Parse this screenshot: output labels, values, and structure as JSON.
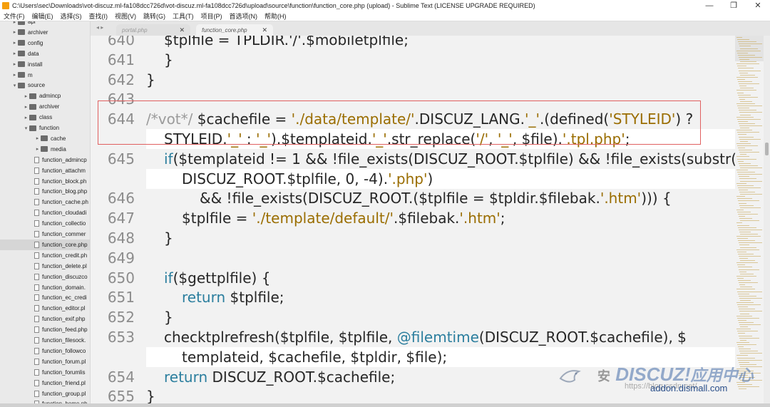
{
  "window": {
    "title": "C:\\Users\\sec\\Downloads\\vot-discuz.ml-fa108dcc726d\\vot-discuz.ml-fa108dcc726d\\upload\\source\\function\\function_core.php (upload) - Sublime Text (LICENSE UPGRADE REQUIRED)",
    "minimize": "—",
    "restore": "❐",
    "close": "✕"
  },
  "menu": [
    "文件(F)",
    "编辑(E)",
    "选择(S)",
    "查找(I)",
    "视图(V)",
    "跳转(G)",
    "工具(T)",
    "项目(P)",
    "首选项(N)",
    "帮助(H)"
  ],
  "sidebar": {
    "items": [
      {
        "label": "api",
        "type": "folder",
        "expanded": false
      },
      {
        "label": "archiver",
        "type": "folder",
        "expanded": false
      },
      {
        "label": "config",
        "type": "folder",
        "expanded": false
      },
      {
        "label": "data",
        "type": "folder",
        "expanded": false
      },
      {
        "label": "install",
        "type": "folder",
        "expanded": false
      },
      {
        "label": "m",
        "type": "folder",
        "expanded": false
      },
      {
        "label": "source",
        "type": "folder",
        "expanded": true
      },
      {
        "label": "admincp",
        "type": "folder",
        "expanded": false
      },
      {
        "label": "archiver",
        "type": "folder",
        "expanded": false
      },
      {
        "label": "class",
        "type": "folder",
        "expanded": false
      },
      {
        "label": "function",
        "type": "folder",
        "expanded": true
      },
      {
        "label": "cache",
        "type": "folder",
        "expanded": false
      },
      {
        "label": "media",
        "type": "folder",
        "expanded": false
      },
      {
        "label": "function_admincp",
        "type": "file"
      },
      {
        "label": "function_attachm",
        "type": "file"
      },
      {
        "label": "function_block.ph",
        "type": "file"
      },
      {
        "label": "function_blog.php",
        "type": "file"
      },
      {
        "label": "function_cache.ph",
        "type": "file"
      },
      {
        "label": "function_cloudadi",
        "type": "file"
      },
      {
        "label": "function_collectio",
        "type": "file"
      },
      {
        "label": "function_commer",
        "type": "file"
      },
      {
        "label": "function_core.php",
        "type": "file",
        "selected": true
      },
      {
        "label": "function_credit.ph",
        "type": "file"
      },
      {
        "label": "function_delete.pl",
        "type": "file"
      },
      {
        "label": "function_discuzco",
        "type": "file"
      },
      {
        "label": "function_domain.",
        "type": "file"
      },
      {
        "label": "function_ec_credi",
        "type": "file"
      },
      {
        "label": "function_editor.pl",
        "type": "file"
      },
      {
        "label": "function_exif.php",
        "type": "file"
      },
      {
        "label": "function_feed.php",
        "type": "file"
      },
      {
        "label": "function_filesock.",
        "type": "file"
      },
      {
        "label": "function_followco",
        "type": "file"
      },
      {
        "label": "function_forum.pl",
        "type": "file"
      },
      {
        "label": "function_forumlis",
        "type": "file"
      },
      {
        "label": "function_friend.pl",
        "type": "file"
      },
      {
        "label": "function_group.pl",
        "type": "file"
      },
      {
        "label": "function_home.ph",
        "type": "file"
      }
    ]
  },
  "tabs": {
    "nav": "◂ ▸",
    "items": [
      {
        "label": "portal.php",
        "active": false,
        "close": "✕"
      },
      {
        "label": "function_core.php",
        "active": true,
        "close": "✕"
      }
    ]
  },
  "editor": {
    "lines": [
      {
        "num": "640",
        "wrap": false,
        "indent": 1,
        "tokens": [
          [
            "$tplfile = TPLDIR.'/'.$mobiletplfile;",
            "plain"
          ]
        ]
      },
      {
        "num": "641",
        "wrap": false,
        "indent": 1,
        "tokens": [
          [
            "}",
            "plain"
          ]
        ]
      },
      {
        "num": "642",
        "wrap": false,
        "indent": 0,
        "tokens": [
          [
            "}",
            "plain"
          ]
        ]
      },
      {
        "num": "643",
        "wrap": false,
        "indent": 0,
        "tokens": []
      },
      {
        "num": "644",
        "wrap": false,
        "indent": 0,
        "tokens": [
          [
            "/*vot*/ ",
            "cmt"
          ],
          [
            "$cachefile = ",
            "plain"
          ],
          [
            "'./data/template/'",
            "str"
          ],
          [
            ".DISCUZ_LANG.",
            "plain"
          ],
          [
            "'_'",
            "str"
          ],
          [
            ".(defined(",
            "plain"
          ],
          [
            "'STYLEID'",
            "str"
          ],
          [
            ") ?",
            "plain"
          ]
        ]
      },
      {
        "num": "",
        "wrap": true,
        "indent": 1,
        "tokens": [
          [
            "STYLEID.",
            "plain"
          ],
          [
            "'_'",
            "str"
          ],
          [
            " : ",
            "plain"
          ],
          [
            "'_'",
            "str"
          ],
          [
            ").$templateid.",
            "plain"
          ],
          [
            "'_'",
            "str"
          ],
          [
            ".str_replace(",
            "plain"
          ],
          [
            "'/'",
            "str"
          ],
          [
            ", ",
            "plain"
          ],
          [
            "'_'",
            "str"
          ],
          [
            ", $file).",
            "plain"
          ],
          [
            "'.tpl.php'",
            "str"
          ],
          [
            ";",
            "plain"
          ]
        ]
      },
      {
        "num": "645",
        "wrap": false,
        "indent": 1,
        "tokens": [
          [
            "if",
            "kw"
          ],
          [
            "($templateid != 1 && !file_exists(DISCUZ_ROOT.$tplfile) && !file_exists(substr(",
            "plain"
          ]
        ]
      },
      {
        "num": "",
        "wrap": true,
        "indent": 2,
        "tokens": [
          [
            "DISCUZ_ROOT.$tplfile, 0, -4).",
            "plain"
          ],
          [
            "'.php'",
            "str"
          ],
          [
            ")",
            "plain"
          ]
        ]
      },
      {
        "num": "646",
        "wrap": false,
        "indent": 3,
        "tokens": [
          [
            "&& !file_exists(DISCUZ_ROOT.($tplfile = $tpldir.$filebak.",
            "plain"
          ],
          [
            "'.htm'",
            "str"
          ],
          [
            "))) {",
            "plain"
          ]
        ]
      },
      {
        "num": "647",
        "wrap": false,
        "indent": 2,
        "tokens": [
          [
            "$tplfile = ",
            "plain"
          ],
          [
            "'./template/default/'",
            "str"
          ],
          [
            ".$filebak.",
            "plain"
          ],
          [
            "'.htm'",
            "str"
          ],
          [
            ";",
            "plain"
          ]
        ]
      },
      {
        "num": "648",
        "wrap": false,
        "indent": 1,
        "tokens": [
          [
            "}",
            "plain"
          ]
        ]
      },
      {
        "num": "649",
        "wrap": false,
        "indent": 0,
        "tokens": []
      },
      {
        "num": "650",
        "wrap": false,
        "indent": 1,
        "tokens": [
          [
            "if",
            "kw"
          ],
          [
            "($gettplfile) {",
            "plain"
          ]
        ]
      },
      {
        "num": "651",
        "wrap": false,
        "indent": 2,
        "tokens": [
          [
            "return",
            "kw"
          ],
          [
            " $tplfile;",
            "plain"
          ]
        ]
      },
      {
        "num": "652",
        "wrap": false,
        "indent": 1,
        "tokens": [
          [
            "}",
            "plain"
          ]
        ]
      },
      {
        "num": "653",
        "wrap": false,
        "indent": 1,
        "tokens": [
          [
            "checktplrefresh($tplfile, $tplfile, ",
            "plain"
          ],
          [
            "@filemtime",
            "kw"
          ],
          [
            "(DISCUZ_ROOT.$cachefile), $",
            "plain"
          ]
        ]
      },
      {
        "num": "",
        "wrap": true,
        "indent": 2,
        "tokens": [
          [
            "templateid, $cachefile, $tpldir, $file);",
            "plain"
          ]
        ]
      },
      {
        "num": "654",
        "wrap": false,
        "indent": 1,
        "tokens": [
          [
            "return",
            "kw"
          ],
          [
            " DISCUZ_ROOT.$cachefile;",
            "plain"
          ]
        ]
      },
      {
        "num": "655",
        "wrap": false,
        "indent": 0,
        "tokens": [
          [
            "}",
            "plain"
          ]
        ]
      }
    ]
  },
  "watermark": {
    "brand": "DISCUZ!",
    "suffix": "应用中心",
    "sub": "https://blog.csdn.net/...",
    "domain": "addon.dismall.com",
    "prefix": "安"
  },
  "colors": {
    "string": "#9a6d00",
    "keyword": "#2b7e9e",
    "comment": "#9b9b9b",
    "highlight": "#e06060"
  }
}
